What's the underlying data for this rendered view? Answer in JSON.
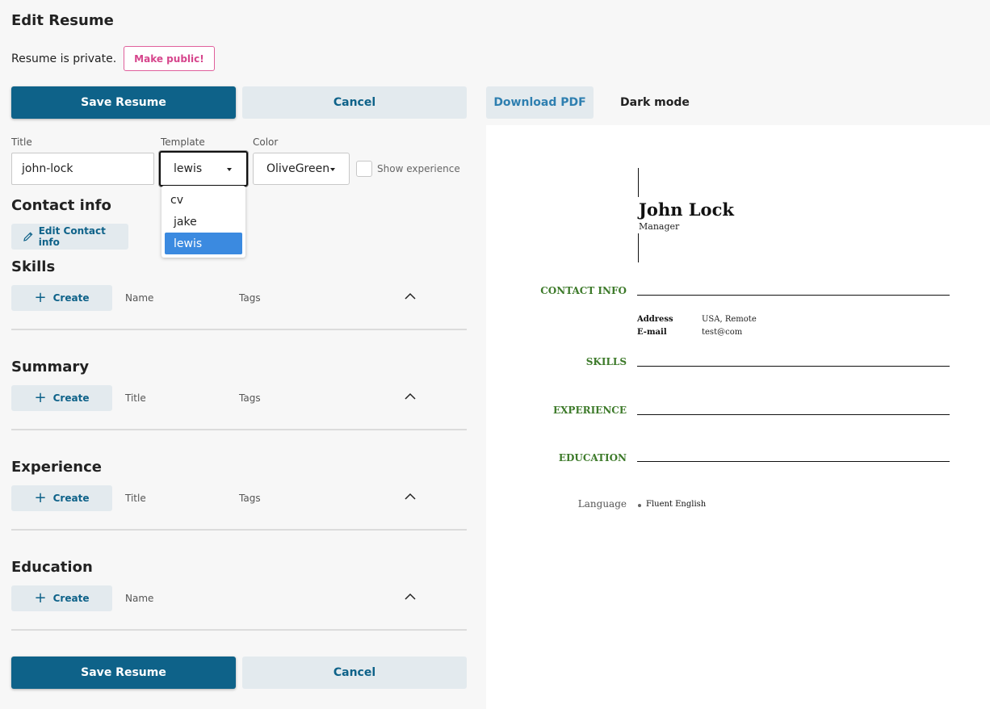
{
  "page": {
    "title": "Edit Resume"
  },
  "privacy": {
    "status_text": "Resume is private.",
    "make_public_label": "Make public!"
  },
  "actions": {
    "save_label": "Save Resume",
    "cancel_label": "Cancel"
  },
  "form": {
    "title": {
      "label": "Title",
      "value": "john-lock"
    },
    "template": {
      "label": "Template",
      "value": "lewis",
      "options": [
        "cv",
        "jake",
        "lewis"
      ]
    },
    "color": {
      "label": "Color",
      "value": "OliveGreen"
    },
    "show_experience": {
      "label": "Show experience",
      "checked": false
    }
  },
  "contact": {
    "title": "Contact info",
    "edit_label": "Edit Contact info"
  },
  "sections": [
    {
      "title": "Skills",
      "create_label": "Create",
      "col1": "Name",
      "col2": "Tags"
    },
    {
      "title": "Summary",
      "create_label": "Create",
      "col1": "Title",
      "col2": "Tags"
    },
    {
      "title": "Experience",
      "create_label": "Create",
      "col1": "Title",
      "col2": "Tags"
    },
    {
      "title": "Education",
      "create_label": "Create",
      "col1": "Name",
      "col2": ""
    }
  ],
  "preview_toolbar": {
    "download_label": "Download PDF",
    "dark_mode_label": "Dark mode"
  },
  "preview": {
    "name": "John Lock",
    "role": "Manager",
    "accent_color": "#3d7a2a",
    "headings": {
      "contact": "CONTACT INFO",
      "skills": "SKILLS",
      "experience": "EXPERIENCE",
      "education": "EDUCATION"
    },
    "contact_rows": [
      {
        "key": "Address",
        "value": "USA, Remote"
      },
      {
        "key": "E-mail",
        "value": "test@com"
      }
    ],
    "language_label": "Language",
    "language_value": "Fluent English"
  }
}
